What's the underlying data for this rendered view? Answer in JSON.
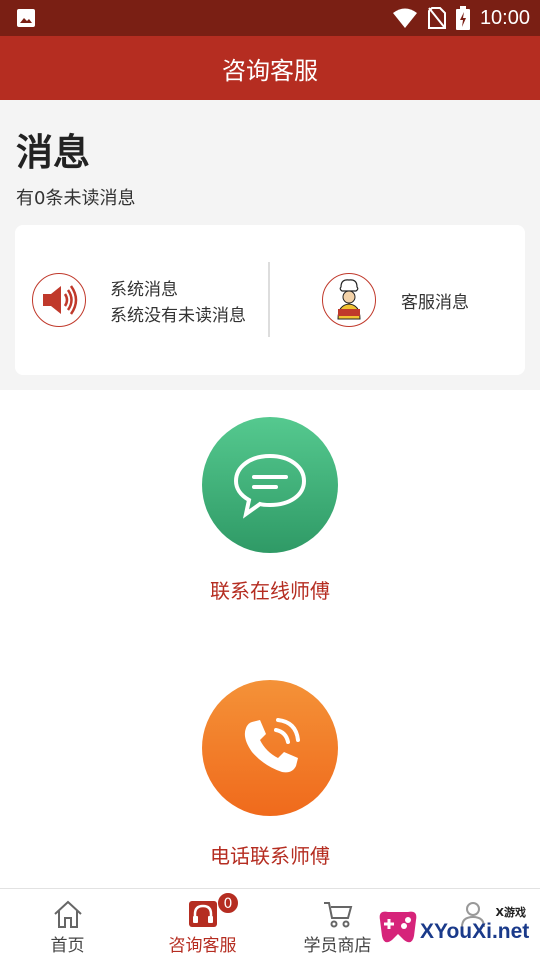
{
  "status_bar": {
    "time": "10:00",
    "icons": [
      "image-icon",
      "wifi-icon",
      "no-sim-icon",
      "battery-charging-icon"
    ]
  },
  "app_bar": {
    "title": "咨询客服"
  },
  "messages": {
    "heading": "消息",
    "unread_summary": "有0条未读消息",
    "system": {
      "title": "系统消息",
      "subtitle": "系统没有未读消息",
      "icon": "speaker-icon"
    },
    "customer_service": {
      "title": "客服消息",
      "icon": "chef-avatar-icon"
    }
  },
  "actions": {
    "chat": {
      "label": "联系在线师傅",
      "icon": "chat-bubble-icon",
      "color": "#3dae78"
    },
    "phone": {
      "label": "电话联系师傅",
      "icon": "phone-icon",
      "color": "#f27a28"
    }
  },
  "tab_bar": {
    "tabs": [
      {
        "label": "首页",
        "icon": "home-icon",
        "active": false
      },
      {
        "label": "咨询客服",
        "icon": "headset-icon",
        "active": true,
        "badge": "0"
      },
      {
        "label": "学员商店",
        "icon": "cart-icon",
        "active": false
      },
      {
        "label": "",
        "icon": "user-icon",
        "active": false
      }
    ]
  },
  "watermark": {
    "small_text": "X游戏",
    "big_text": "XYouXi.net"
  },
  "colors": {
    "primary": "#b52d21",
    "status_bar": "#7a1f14",
    "background": "#f4f4f4"
  }
}
